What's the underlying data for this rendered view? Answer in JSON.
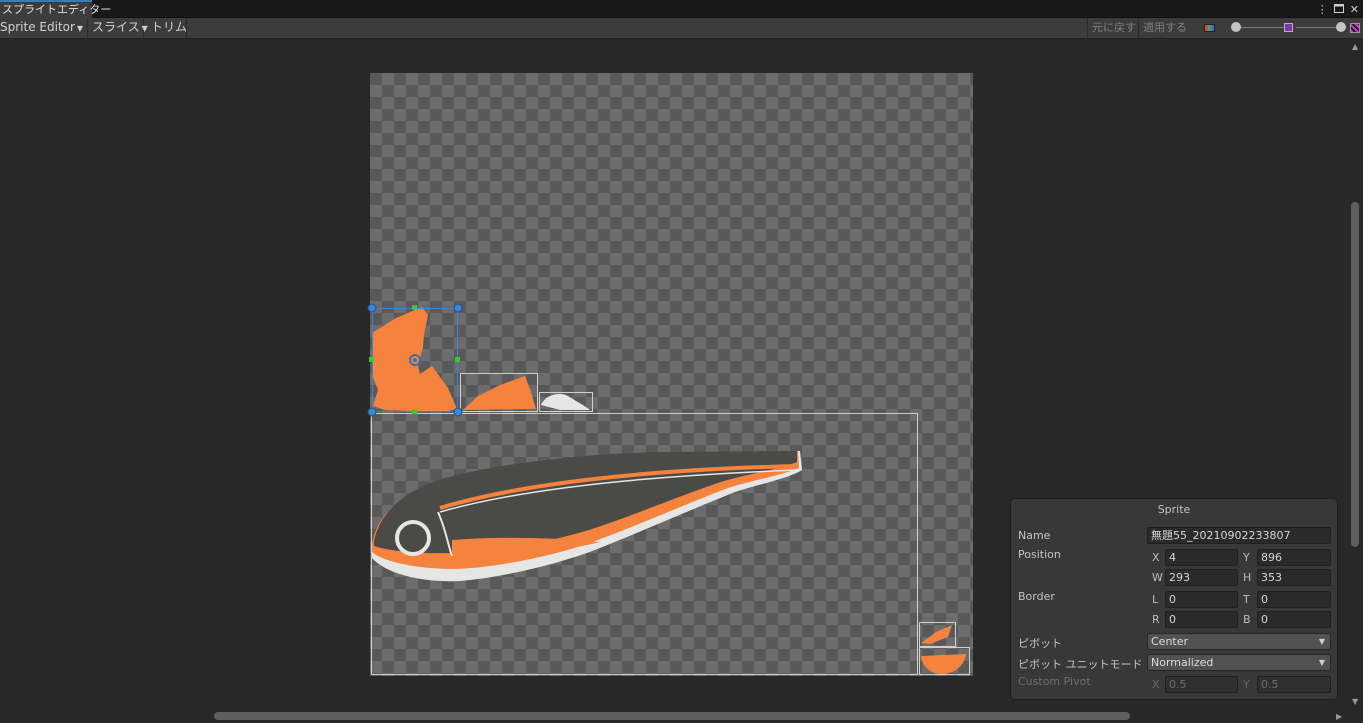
{
  "window": {
    "tab_title": "スプライトエディター",
    "menu_icon": "kebab-menu-icon",
    "maximize_icon": "maximize-icon",
    "close_icon": "close-icon"
  },
  "toolbar": {
    "mode_dropdown": "Sprite Editor",
    "slice_dropdown": "スライス",
    "trim_button": "トリム",
    "revert_button": "元に戻す",
    "apply_button": "適用する",
    "color_channel_icon": "rgb-channel-icon",
    "mip_icon": "mip-level-icon",
    "alpha_icon": "alpha-toggle-icon",
    "zoom_fraction": 0.95,
    "mip_fraction": 1.0
  },
  "canvas": {
    "texture": "sprite-sheet-fish",
    "colors": {
      "orange": "#f5833d",
      "body": "#4a4a46",
      "belly": "#e6e6e4",
      "selection": "#3a86d8",
      "handle": "#2bd22b"
    }
  },
  "sprite_panel": {
    "title": "Sprite",
    "name_label": "Name",
    "name_value": "無題55_20210902233807",
    "position_label": "Position",
    "x_label": "X",
    "x_value": "4",
    "y_label": "Y",
    "y_value": "896",
    "w_label": "W",
    "w_value": "293",
    "h_label": "H",
    "h_value": "353",
    "border_label": "Border",
    "l_label": "L",
    "l_value": "0",
    "t_label": "T",
    "t_value": "0",
    "r_label": "R",
    "r_value": "0",
    "b_label": "B",
    "b_value": "0",
    "pivot_label": "ピボット",
    "pivot_value": "Center",
    "pivot_unit_label": "ピボット ユニットモード",
    "pivot_unit_value": "Normalized",
    "custom_pivot_label": "Custom Pivot",
    "custom_x_label": "X",
    "custom_x_value": "0.5",
    "custom_y_label": "Y",
    "custom_y_value": "0.5"
  }
}
